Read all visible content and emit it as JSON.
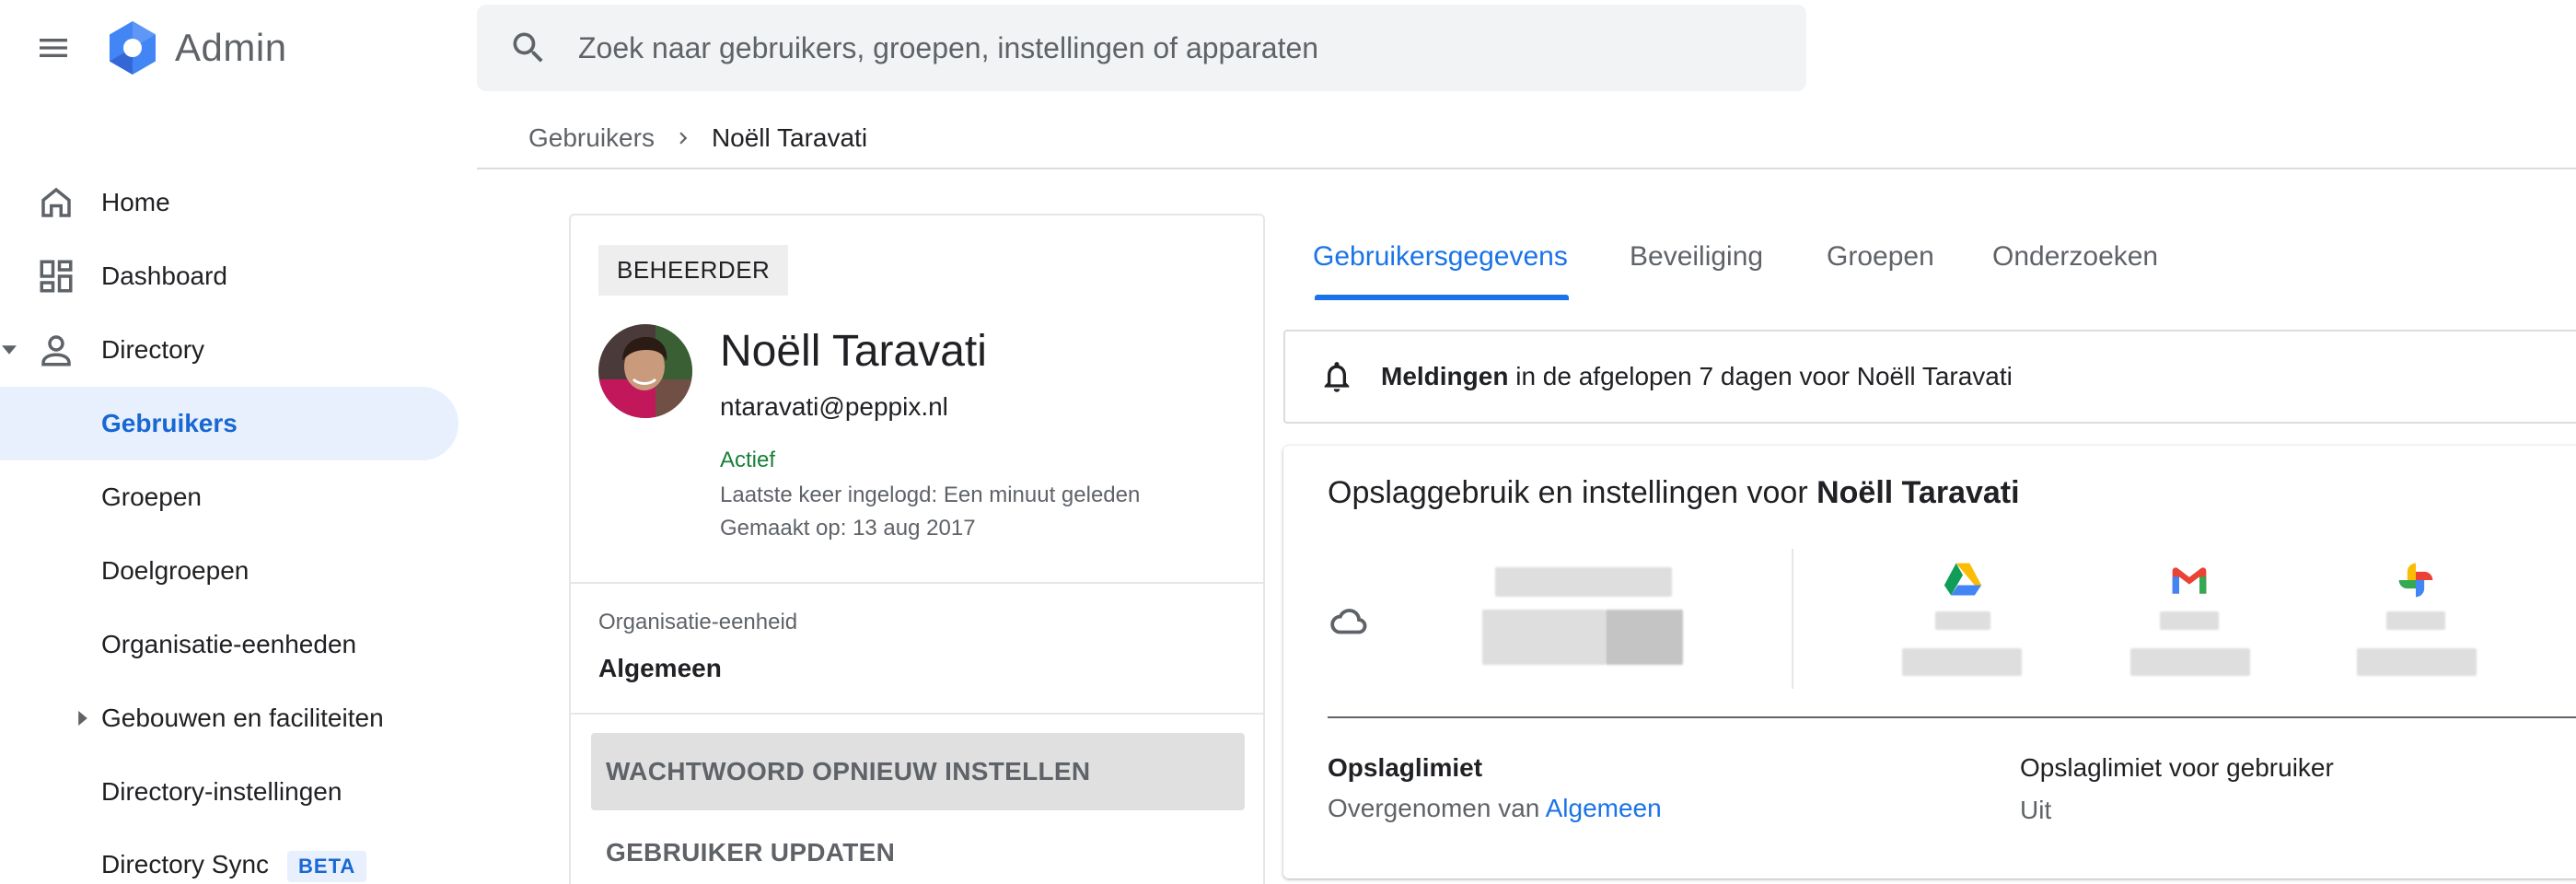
{
  "app": {
    "title": "Admin",
    "search_placeholder": "Zoek naar gebruikers, groepen, instellingen of apparaten"
  },
  "breadcrumb": {
    "parent": "Gebruikers",
    "current": "Noëll Taravati"
  },
  "sidebar": {
    "items": [
      {
        "label": "Home",
        "icon": "home-icon"
      },
      {
        "label": "Dashboard",
        "icon": "dashboard-icon"
      },
      {
        "label": "Directory",
        "icon": "person-icon",
        "expanded": true
      },
      {
        "label": "Gebruikers",
        "active": true
      },
      {
        "label": "Groepen"
      },
      {
        "label": "Doelgroepen"
      },
      {
        "label": "Organisatie-eenheden"
      },
      {
        "label": "Gebouwen en faciliteiten",
        "expandable": true
      },
      {
        "label": "Directory-instellingen"
      },
      {
        "label": "Directory Sync",
        "badge": "BETA"
      }
    ]
  },
  "user": {
    "role": "BEHEERDER",
    "name": "Noëll Taravati",
    "email": "ntaravati@peppix.nl",
    "status": "Actief",
    "last_login": "Laatste keer ingelogd: Een minuut geleden",
    "created": "Gemaakt op: 13 aug 2017",
    "org_unit_label": "Organisatie-eenheid",
    "org_unit_value": "Algemeen",
    "actions": {
      "reset_password": "WACHTWOORD OPNIEUW INSTELLEN",
      "update_user": "GEBRUIKER UPDATEN"
    }
  },
  "tabs": [
    {
      "label": "Gebruikersgegevens",
      "active": true
    },
    {
      "label": "Beveiliging"
    },
    {
      "label": "Groepen"
    },
    {
      "label": "Onderzoeken"
    }
  ],
  "notification": {
    "bold": "Meldingen",
    "rest": " in de afgelopen 7 dagen voor Noëll Taravati"
  },
  "storage": {
    "title_prefix": "Opslaggebruik en instellingen voor ",
    "title_name": "Noëll Taravati",
    "services": [
      "drive-icon",
      "gmail-icon",
      "photos-icon"
    ],
    "limit_label": "Opslaglimiet",
    "limit_inherited_prefix": "Overgenomen van ",
    "limit_inherited_link": "Algemeen",
    "user_limit_label": "Opslaglimiet voor gebruiker",
    "user_limit_value": "Uit"
  },
  "colors": {
    "accent": "#1a73e8",
    "active_nav_bg": "#e8f0fe",
    "status_green": "#188038"
  }
}
